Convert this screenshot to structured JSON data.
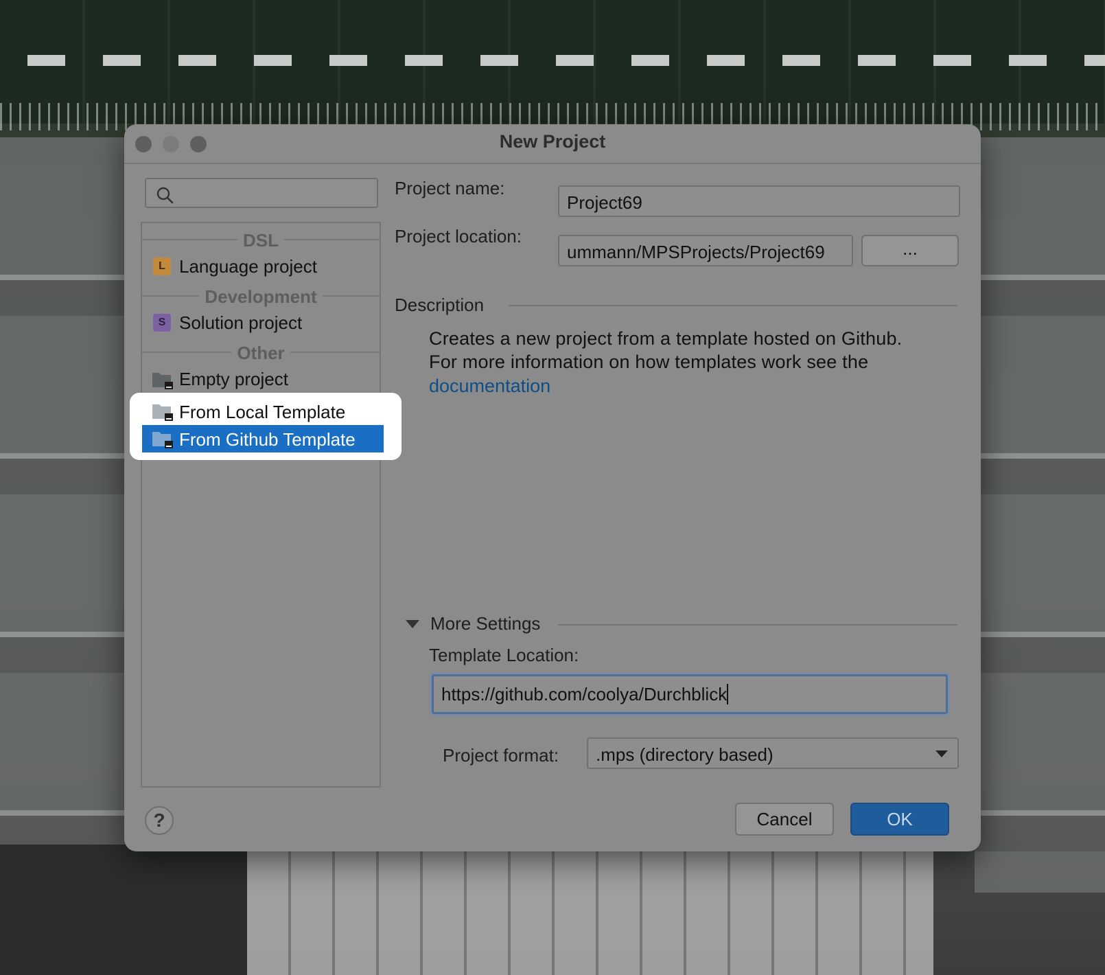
{
  "window": {
    "title": "New Project"
  },
  "sidebar": {
    "search": {
      "placeholder": ""
    },
    "groups": [
      {
        "label": "DSL"
      },
      {
        "label": "Development"
      },
      {
        "label": "Other"
      }
    ],
    "items": [
      {
        "label": "Language project",
        "badge": "L",
        "icon": "language-badge-icon"
      },
      {
        "label": "Solution project",
        "badge": "S",
        "icon": "solution-badge-icon"
      },
      {
        "label": "Empty project",
        "icon": "folder-icon"
      },
      {
        "label": "From Local Template",
        "icon": "folder-icon"
      },
      {
        "label": "From Github Template",
        "icon": "folder-icon",
        "selected": true
      }
    ]
  },
  "form": {
    "project_name_label": "Project name:",
    "project_name_value": "Project69",
    "project_location_label": "Project location:",
    "project_location_value": "ummann/MPSProjects/Project69",
    "browse_label": "...",
    "description_header": "Description",
    "description_line1": "Creates a new project from a template hosted on Github.",
    "description_line2": "For more information on how templates work see the",
    "description_link": "documentation",
    "more_settings_label": "More Settings",
    "template_location_label": "Template Location:",
    "template_location_value": "https://github.com/coolya/Durchblick",
    "project_format_label": "Project format:",
    "project_format_value": ".mps (directory based)"
  },
  "footer": {
    "help_label": "?",
    "cancel_label": "Cancel",
    "ok_label": "OK"
  },
  "colors": {
    "selection": "#1a6fc4",
    "ok_button": "#1e5c9b",
    "link": "#0e4e86",
    "focus_border": "#4b6f98"
  }
}
